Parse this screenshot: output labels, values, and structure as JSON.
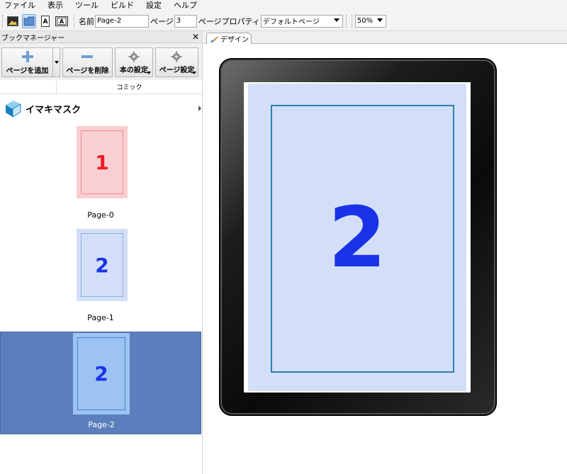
{
  "menu": [
    "ファイル",
    "表示",
    "ツール",
    "ビルド",
    "設定",
    "ヘルプ"
  ],
  "toolbar": {
    "name_label": "名前",
    "name_value": "Page-2",
    "page_label": "ページ",
    "page_value": "3",
    "property_label": "ページプロパティ",
    "property_value": "デフォルトページ",
    "zoom_value": "50%"
  },
  "book_manager": {
    "title": "ブックマネージャー",
    "close_glyph": "✕",
    "buttons": {
      "add_page": "ページを追加",
      "delete_page": "ページを削除",
      "book_settings": "本の設定",
      "page_settings": "ページ設定"
    },
    "column_header": "コミック",
    "book_title": "イマキマスク",
    "pages": [
      {
        "label": "Page-0",
        "number": "1"
      },
      {
        "label": "Page-1",
        "number": "2"
      },
      {
        "label": "Page-2",
        "number": "2"
      }
    ]
  },
  "design": {
    "tab_label": "デザイン",
    "page_number": "2"
  },
  "colors": {
    "selection": "#5b7fbd",
    "page_red_bg": "#f9cfd2",
    "page_red_text": "#ee1c24",
    "page_blue_bg": "#d3dff8",
    "page_blue_text": "#1932e8",
    "frame": "#2e7fae"
  }
}
